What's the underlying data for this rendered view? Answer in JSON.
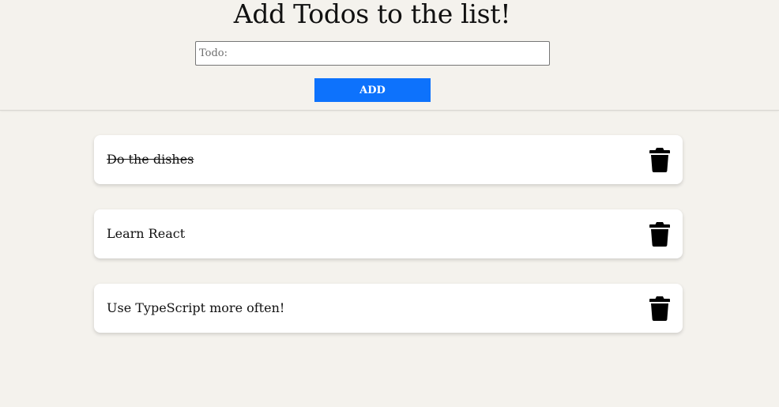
{
  "header": {
    "title": "Add Todos to the list!",
    "input_placeholder": "Todo:",
    "input_value": "",
    "add_label": "ADD"
  },
  "colors": {
    "background": "#f4f2ed",
    "accent": "#0d72fc",
    "card": "#ffffff"
  },
  "todos": [
    {
      "text": "Do the dishes",
      "done": true,
      "delete_icon": "trash-icon"
    },
    {
      "text": "Learn React",
      "done": false,
      "delete_icon": "trash-icon"
    },
    {
      "text": "Use TypeScript more often!",
      "done": false,
      "delete_icon": "trash-icon"
    }
  ]
}
